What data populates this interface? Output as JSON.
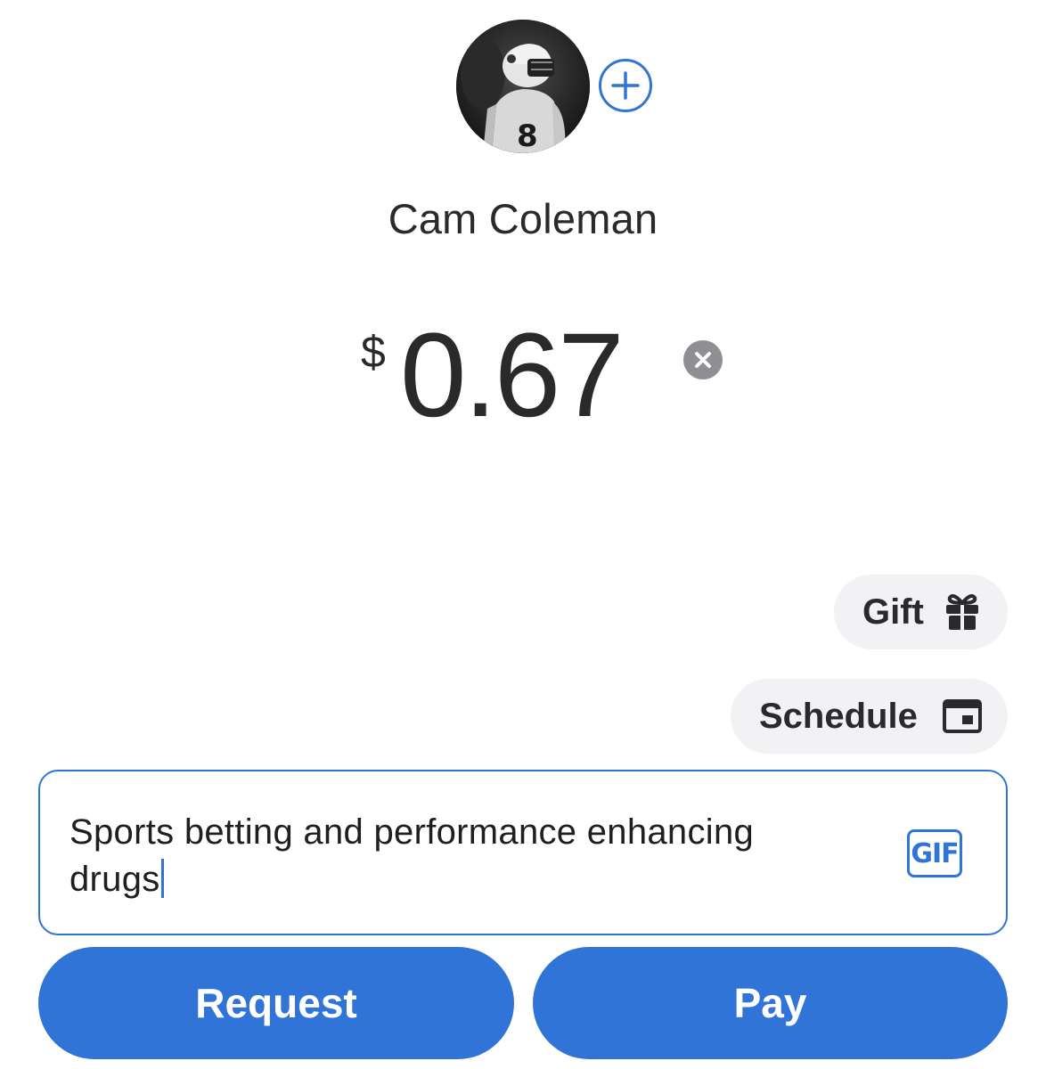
{
  "recipient": {
    "name": "Cam Coleman",
    "avatar_icon": "player-photo-avatar",
    "add_icon": "plus-icon"
  },
  "amount": {
    "currency_symbol": "$",
    "value": "0.67",
    "clear_icon": "close-icon"
  },
  "options": {
    "gift_label": "Gift",
    "gift_icon": "gift-icon",
    "schedule_label": "Schedule",
    "schedule_icon": "calendar-icon"
  },
  "note": {
    "text": "Sports betting and performance enhancing drugs",
    "gif_label": "GIF"
  },
  "actions": {
    "request_label": "Request",
    "pay_label": "Pay"
  },
  "colors": {
    "accent": "#3074d8",
    "pill_bg": "#f2f2f4",
    "text": "#2a2a2d",
    "clear_bg": "#8e8e93"
  }
}
